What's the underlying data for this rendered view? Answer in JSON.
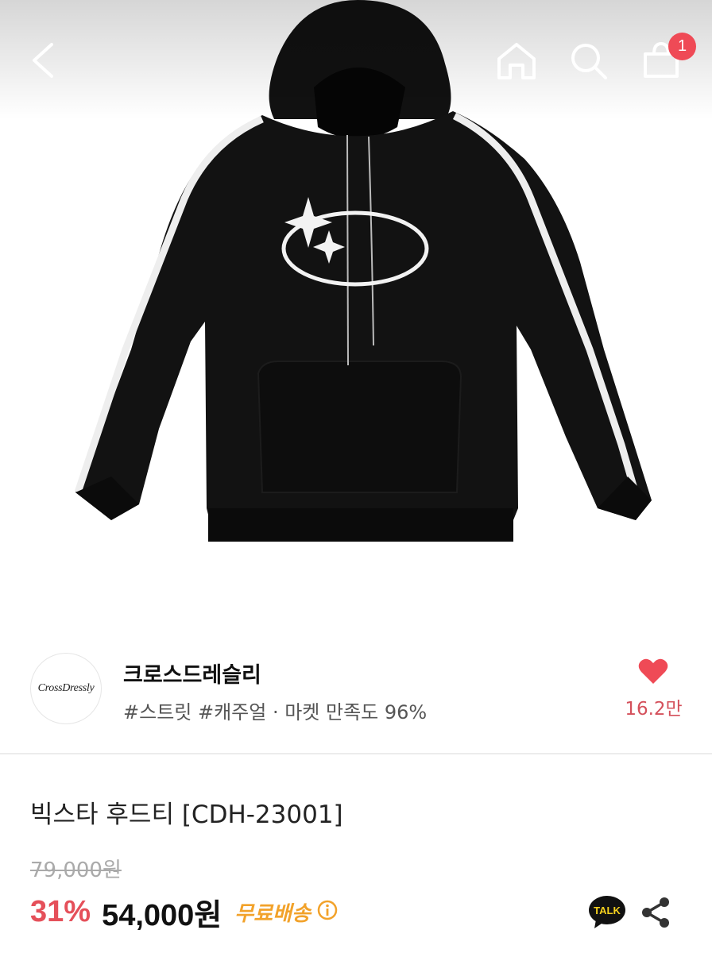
{
  "header": {
    "back_icon": "chevron-left-icon",
    "home_icon": "home-icon",
    "search_icon": "search-icon",
    "cart_icon": "shopping-bag-icon",
    "cart_badge": "1",
    "badge_color": "#ef4a56"
  },
  "product_image": {
    "alt": "product-photo"
  },
  "shop": {
    "logo_text": "CrossDressly",
    "name": "크로스드레슬리",
    "tags": "#스트릿 #캐주얼 · 마켓 만족도 96%",
    "like_icon": "heart-icon",
    "like_count": "16.2만",
    "like_color": "#ef4a56"
  },
  "product": {
    "name": "빅스타 후드티 [CDH-23001]",
    "original_price": "79,000원",
    "discount": "31%",
    "price": "54,000원",
    "shipping": "무료배송",
    "shipping_color": "#f2a22a",
    "info_icon": "info-icon"
  },
  "actions": {
    "talk_label": "TALK",
    "share_icon": "share-icon"
  }
}
